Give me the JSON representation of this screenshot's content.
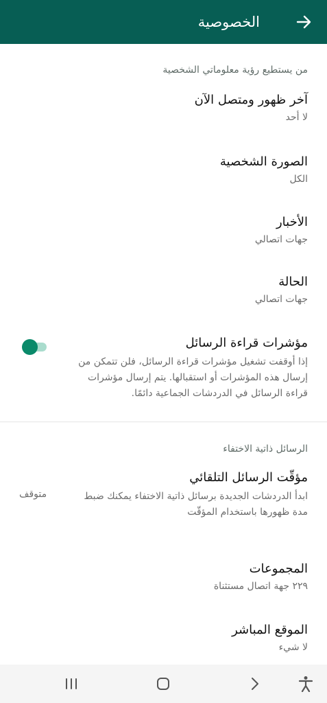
{
  "appbar": {
    "title": "الخصوصية",
    "back_icon": "arrow-back-icon"
  },
  "section_personal": {
    "header": "من يستطيع رؤية معلوماتي الشخصية",
    "items": [
      {
        "title": "آخر ظهور ومتصل الآن",
        "value": "لا أحد"
      },
      {
        "title": "الصورة الشخصية",
        "value": "الكل"
      },
      {
        "title": "الأخبار",
        "value": "جهات اتصالي"
      },
      {
        "title": "الحالة",
        "value": "جهات اتصالي"
      }
    ]
  },
  "read_receipts": {
    "title": "مؤشرات قراءة الرسائل",
    "description": "إذا أوقفت تشغيل مؤشرات قراءة الرسائل، فلن تتمكن من إرسال هذه المؤشرات أو استقبالها. يتم إرسال مؤشرات قراءة الرسائل في الدردشات الجماعية دائمًا.",
    "enabled": true
  },
  "section_disappearing": {
    "header": "الرسائل ذاتية الاختفاء",
    "timer": {
      "title": "مؤقّت الرسائل التلقائي",
      "description": "ابدأ الدردشات الجديدة برسائل ذاتية الاختفاء يمكنك ضبط مدة ظهورها باستخدام المؤقّت",
      "value": "متوقف"
    }
  },
  "groups": {
    "title": "المجموعات",
    "value": "٢٢٩ جهة اتصال مستثناة"
  },
  "live_location": {
    "title": "الموقع المباشر",
    "value": "لا شيء"
  },
  "colors": {
    "appbar": "#075e54",
    "toggle_knob": "#0a8a6a",
    "toggle_track": "#a9dccd"
  },
  "navbar": {
    "icons": [
      "accessibility-icon",
      "back-nav-icon",
      "home-nav-icon",
      "recents-nav-icon"
    ]
  }
}
